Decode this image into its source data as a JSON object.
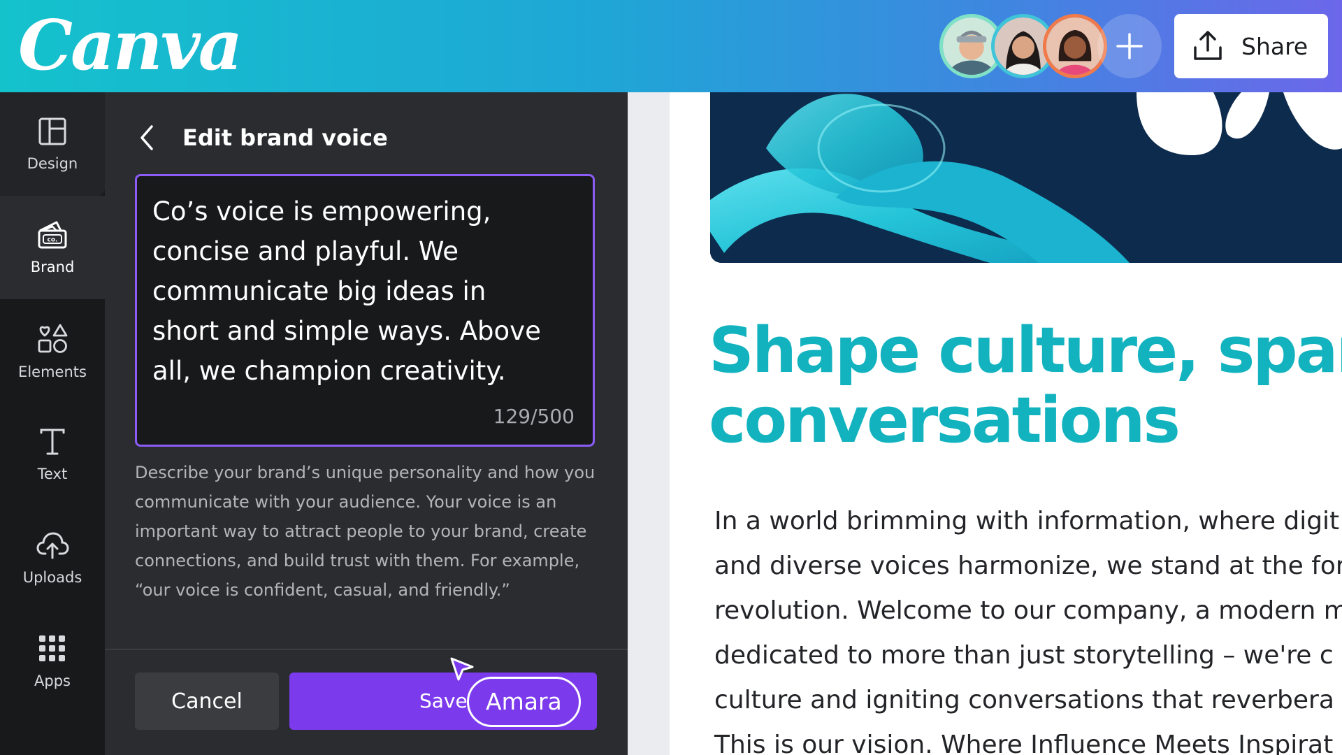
{
  "app": {
    "logo_text": "Canva"
  },
  "header": {
    "collaborators": [
      {
        "name": "Collaborator 1"
      },
      {
        "name": "Collaborator 2"
      },
      {
        "name": "Collaborator 3"
      }
    ],
    "share_label": "Share"
  },
  "rail": {
    "items": [
      {
        "label": "Design",
        "icon": "layout-icon"
      },
      {
        "label": "Brand",
        "icon": "brand-kit-icon"
      },
      {
        "label": "Elements",
        "icon": "shapes-icon"
      },
      {
        "label": "Text",
        "icon": "text-icon"
      },
      {
        "label": "Uploads",
        "icon": "cloud-upload-icon"
      },
      {
        "label": "Apps",
        "icon": "apps-grid-icon"
      }
    ],
    "active": "Brand"
  },
  "panel": {
    "title": "Edit brand voice",
    "voice_text": "Co’s voice is empowering,\nconcise and playful. We\ncommunicate big ideas in\nshort and simple ways. Above\nall, we champion creativity.",
    "counter": "129/500",
    "help_text": "Describe your brand’s unique personality and how you communicate with your audience. Your voice is an important way to attract people to your brand, create connections, and build trust with them. For example, “our voice is confident, casual, and friendly.”",
    "cancel_label": "Cancel",
    "save_label": "Save",
    "cursor_user": "Amara"
  },
  "canvas": {
    "headline_line1": "Shape culture, spar",
    "headline_line2": "conversations",
    "body_lines": [
      "In a world brimming with information, where digit",
      "and diverse voices harmonize, we stand at the for",
      "revolution. Welcome to our company, a modern m",
      "dedicated to more than just storytelling – we're c",
      "culture and igniting conversations that reverbera",
      "This is our vision. Where Influence Meets Inspirat"
    ]
  },
  "colors": {
    "accent_purple": "#7c3aed",
    "headline_teal": "#12b3bf",
    "panel_bg": "#2b2c30",
    "rail_bg": "#18191b"
  }
}
